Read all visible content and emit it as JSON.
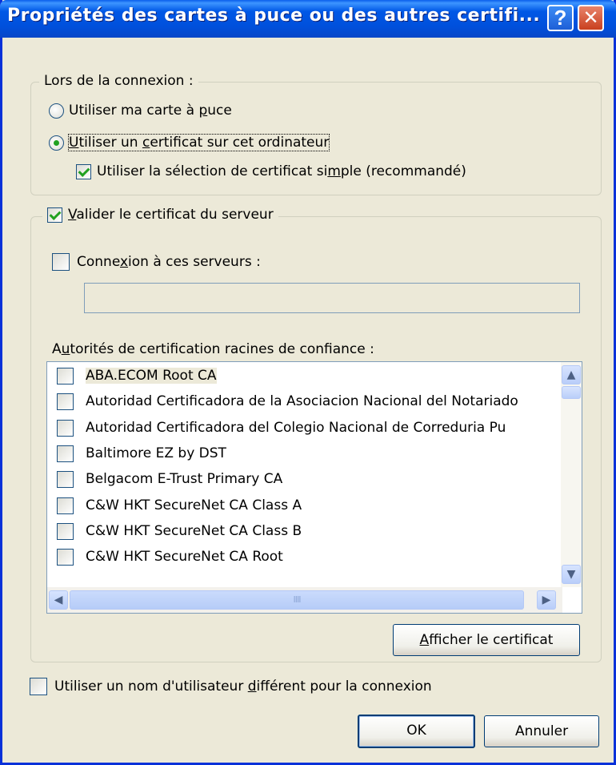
{
  "window": {
    "title": "Propriétés des cartes à puce ou des autres certifi...",
    "help_icon": "?",
    "close_icon": "✕"
  },
  "connection_group": {
    "legend": "Lors de la connexion :",
    "radio_smartcard": {
      "pre": "Utiliser ma carte à ",
      "u": "p",
      "post": "uce",
      "selected": false
    },
    "radio_certificate": {
      "pre": "",
      "u": "U",
      "post": "tiliser un ",
      "u2": "c",
      "post2": "ertificat sur cet ordinateur",
      "selected": true
    },
    "simple_selection": {
      "pre": "Utiliser la sélection de certificat si",
      "u": "m",
      "post": "ple (recommandé)",
      "checked": true
    }
  },
  "server_group": {
    "validate": {
      "u": "V",
      "post": "alider le certificat du serveur",
      "checked": true
    },
    "connect_servers": {
      "pre": "Conne",
      "u": "x",
      "post": "ion à ces serveurs :",
      "checked": false,
      "value": ""
    },
    "trusted_roots_label": {
      "pre": "A",
      "u": "u",
      "post": "torités de certification racines de confiance :"
    },
    "authorities": [
      "ABA.ECOM Root CA",
      "Autoridad Certificadora de la Asociacion Nacional del Notariado",
      "Autoridad Certificadora del Colegio Nacional de Correduria Pu",
      "Baltimore EZ by DST",
      "Belgacom E-Trust Primary CA",
      "C&W HKT SecureNet CA Class A",
      "C&W HKT SecureNet CA Class B",
      "C&W HKT SecureNet CA Root"
    ],
    "view_cert_button": {
      "u": "A",
      "post": "fficher le certificat"
    }
  },
  "different_user": {
    "pre": "Utiliser un nom d'utilisateur ",
    "u": "d",
    "post": "ifférent pour la connexion",
    "checked": false
  },
  "buttons": {
    "ok": "OK",
    "cancel": "Annuler"
  },
  "scrollbar_glyphs": {
    "up": "▲",
    "down": "▼",
    "left": "◀",
    "right": "▶",
    "grip": "IIII"
  }
}
